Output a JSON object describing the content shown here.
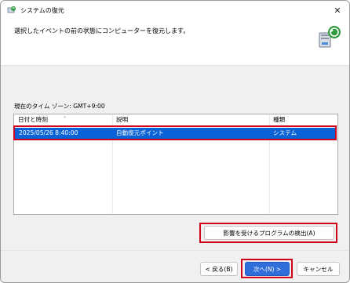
{
  "window": {
    "title": "システムの復元",
    "close_glyph": "✕",
    "icon": "system-restore-icon"
  },
  "header": {
    "text": "選択したイベントの前の状態にコンピューターを復元します。",
    "icon": "system-restore-large-icon"
  },
  "timezone_label": "現在のタイム ゾーン: GMT+9:00",
  "list": {
    "columns": [
      "日付と時刻",
      "説明",
      "種類"
    ],
    "rows": [
      {
        "date": "2025/05/26 8:40:00",
        "description": "自動復元ポイント",
        "type": "システム",
        "selected": true
      }
    ]
  },
  "buttons": {
    "scan": "影響を受けるプログラムの検出(A)",
    "back": "< 戻る(B)",
    "next": "次へ(N) >",
    "cancel": "キャンセル"
  },
  "colors": {
    "selection": "#0a63d6",
    "highlight_border": "#d0021b",
    "primary_button": "#2f6ed8"
  }
}
